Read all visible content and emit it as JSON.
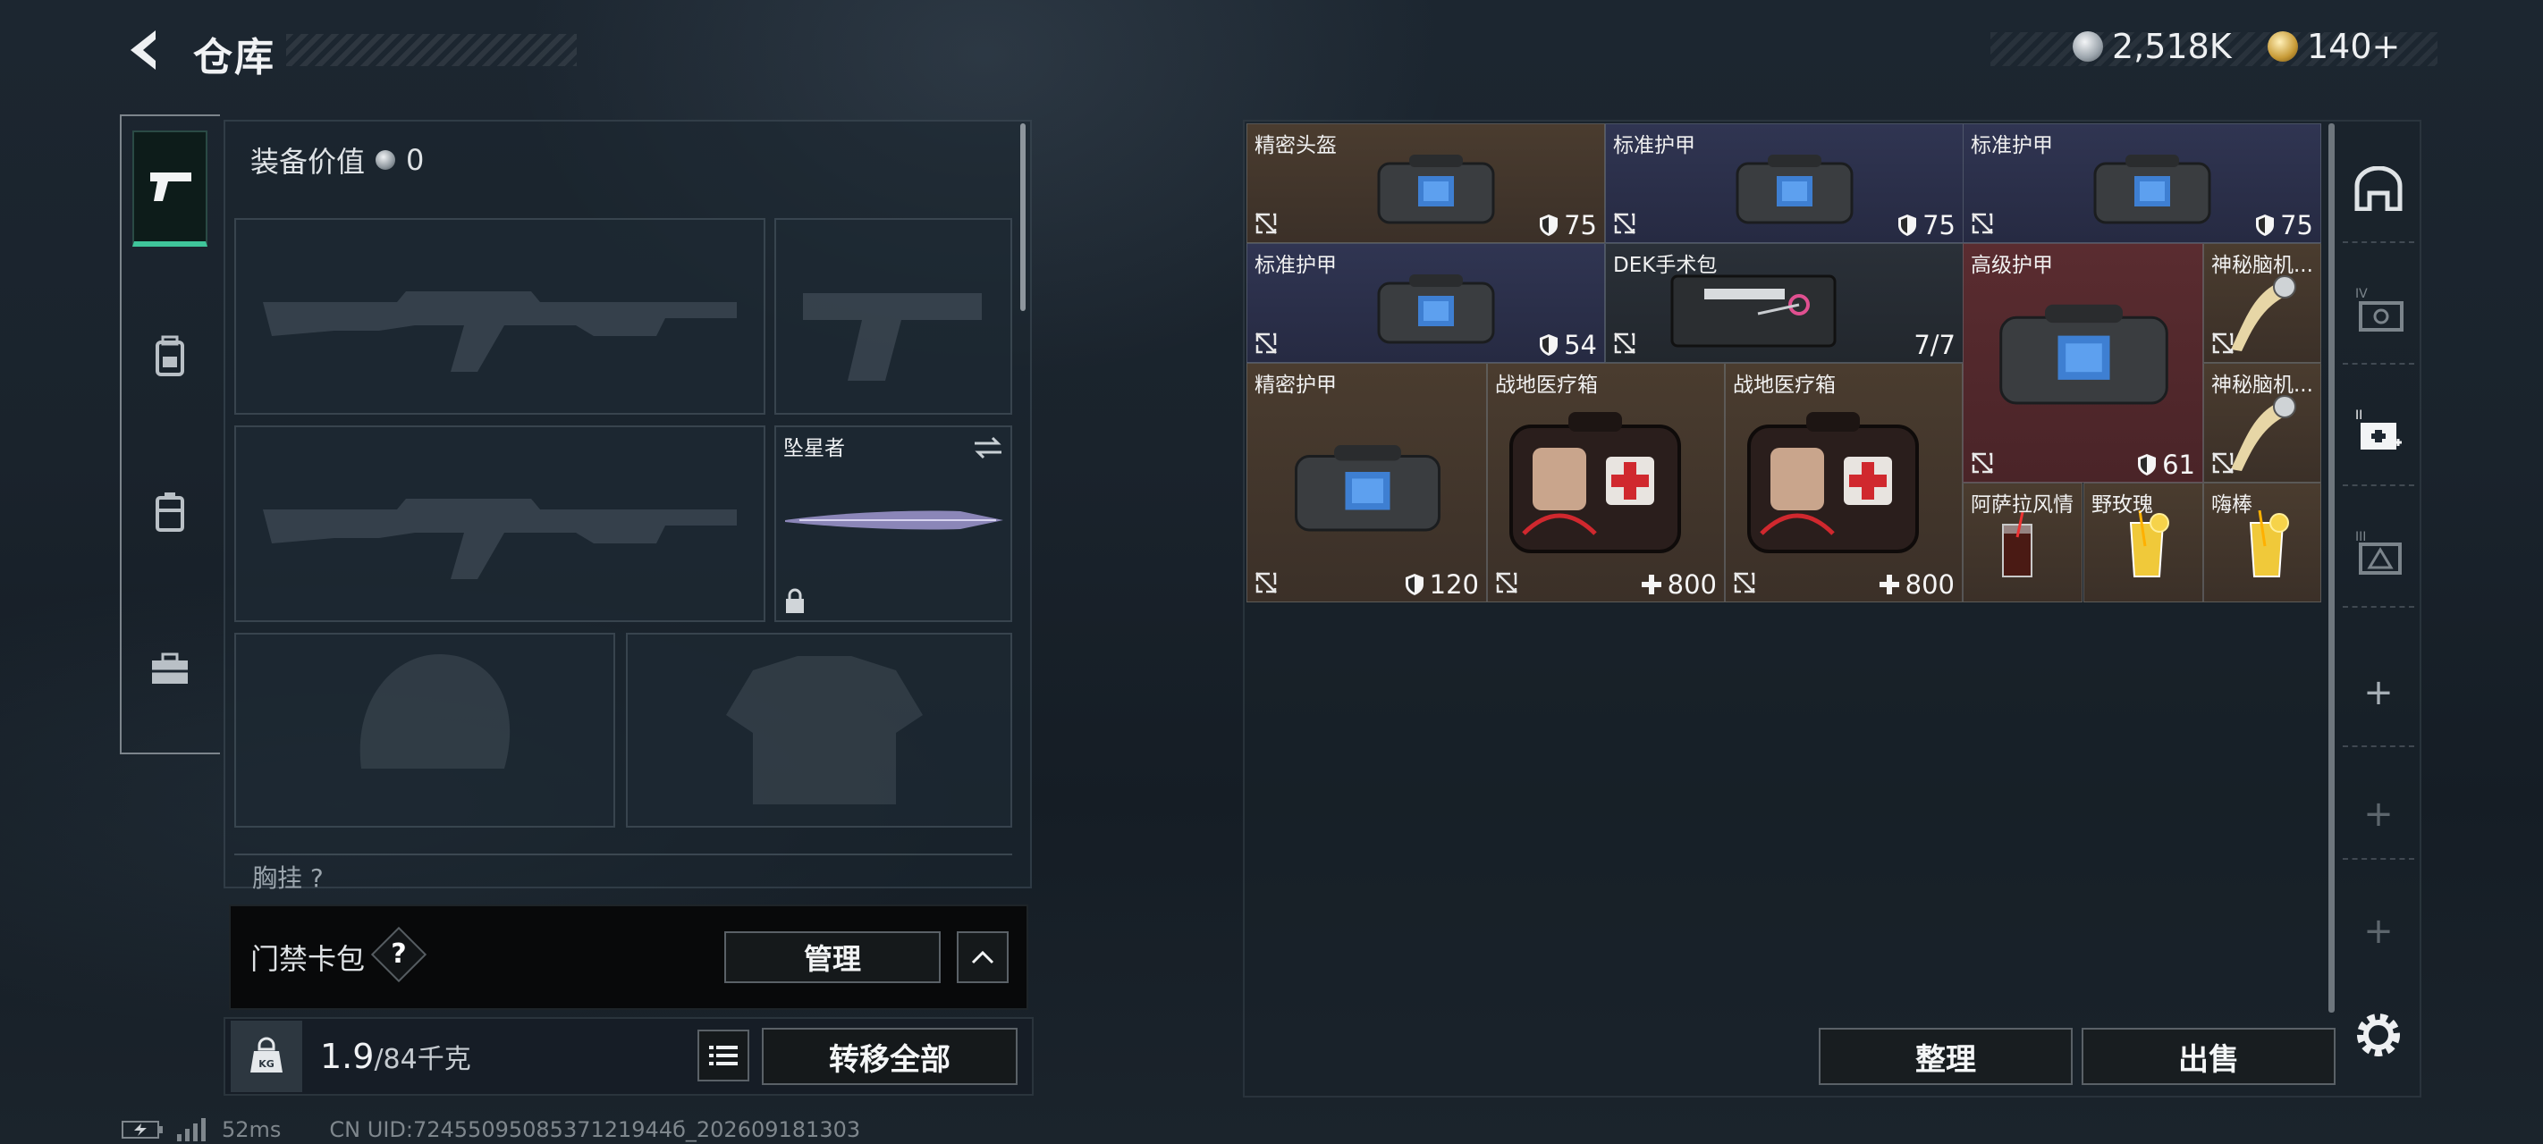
{
  "header": {
    "title": "仓库",
    "back_icon": "back-arrow-icon"
  },
  "currency": {
    "silver_value": "2,518K",
    "gold_value": "140+"
  },
  "left_tabs": [
    {
      "name": "firearms-tab",
      "icon": "pistol-icon",
      "active": true
    },
    {
      "name": "gear-tab",
      "icon": "backpack-icon",
      "active": false
    },
    {
      "name": "vest-tab",
      "icon": "chest-rig-icon",
      "active": false
    },
    {
      "name": "toolbox-tab",
      "icon": "toolbox-icon",
      "active": false
    }
  ],
  "equipment": {
    "value_label": "装备价值",
    "value": "0",
    "melee_name": "坠星者",
    "chest_label": "胸挂",
    "chest_suffix": "?"
  },
  "keycard": {
    "label": "门禁卡包",
    "help": "?",
    "manage_label": "管理"
  },
  "weight": {
    "current": "1.9",
    "max": "/84千克",
    "icon_text": "KG",
    "transfer_label": "转移全部"
  },
  "status": {
    "ping": "52ms",
    "uid": "CN UID:7245509508537121944б_202609181303"
  },
  "stash_items": [
    {
      "name": "精密头盔",
      "value": "75",
      "value_icon": "armor-shield-icon",
      "color": "#4a3c2f"
    },
    {
      "name": "标准护甲",
      "value": "75",
      "value_icon": "armor-shield-icon",
      "color": "#303552"
    },
    {
      "name": "标准护甲",
      "value": "75",
      "value_icon": "armor-shield-icon",
      "color": "#303552"
    },
    {
      "name": "标准护甲",
      "value": "54",
      "value_icon": "armor-shield-icon",
      "color": "#303552"
    },
    {
      "name": "DEK手术包",
      "value": "7/7",
      "value_icon": "",
      "color": "#2a3038"
    },
    {
      "name": "高级护甲",
      "value": "61",
      "value_icon": "armor-shield-icon",
      "color": "#5a2c30"
    },
    {
      "name": "神秘脑机...",
      "value": "",
      "value_icon": "",
      "color": "#4a3c2f"
    },
    {
      "name": "神秘脑机...",
      "value": "",
      "value_icon": "",
      "color": "#4a3c2f"
    },
    {
      "name": "精密护甲",
      "value": "120",
      "value_icon": "armor-shield-icon",
      "color": "#4a3c2f"
    },
    {
      "name": "战地医疗箱",
      "value": "800",
      "value_icon": "medical-plus-icon",
      "color": "#4a3c2f"
    },
    {
      "name": "战地医疗箱",
      "value": "800",
      "value_icon": "medical-plus-icon",
      "color": "#4a3c2f"
    },
    {
      "name": "阿萨拉风情",
      "value": "",
      "value_icon": "",
      "color": "#4a3c2f"
    },
    {
      "name": "野玫瑰",
      "value": "",
      "value_icon": "",
      "color": "#4a3c2f"
    },
    {
      "name": "嗨棒",
      "value": "",
      "value_icon": "",
      "color": "#4a3c2f"
    }
  ],
  "right_side": {
    "sections": [
      "IV",
      "III",
      "II"
    ]
  },
  "actions": {
    "sort_label": "整理",
    "sell_label": "出售"
  }
}
